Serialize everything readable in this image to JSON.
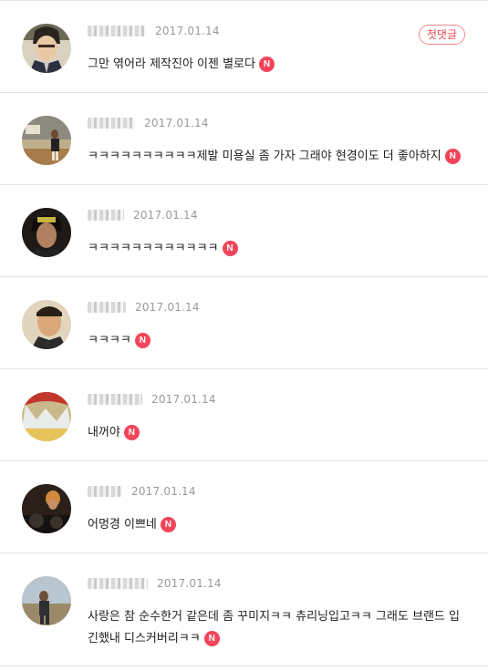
{
  "comments": [
    {
      "date": "2017.01.14",
      "text": "그만 엮어라 제작진아 이젠 별로다",
      "badge": "N",
      "first_badge": "첫댓글"
    },
    {
      "date": "2017.01.14",
      "text": "ㅋㅋㅋㅋㅋㅋㅋㅋㅋㅋ제발 미용실 좀 가자 그래야 현경이도 더 좋아하지",
      "badge": "N"
    },
    {
      "date": "2017.01.14",
      "text": "ㅋㅋㅋㅋㅋㅋㅋㅋㅋㅋㅋㅋ",
      "badge": "N"
    },
    {
      "date": "2017.01.14",
      "text": "ㅋㅋㅋㅋ",
      "badge": "N"
    },
    {
      "date": "2017.01.14",
      "text": "내꺼야",
      "badge": "N"
    },
    {
      "date": "2017.01.14",
      "text": "어멍경 이쁘네",
      "badge": "N"
    },
    {
      "date": "2017.01.14",
      "text": "사랑은 참 순수한거 같은데 좀 꾸미지ㅋㅋ 츄리닝입고ㅋㅋ 그래도 브랜드 입긴했내 디스커버리ㅋㅋ",
      "badge": "N"
    }
  ]
}
